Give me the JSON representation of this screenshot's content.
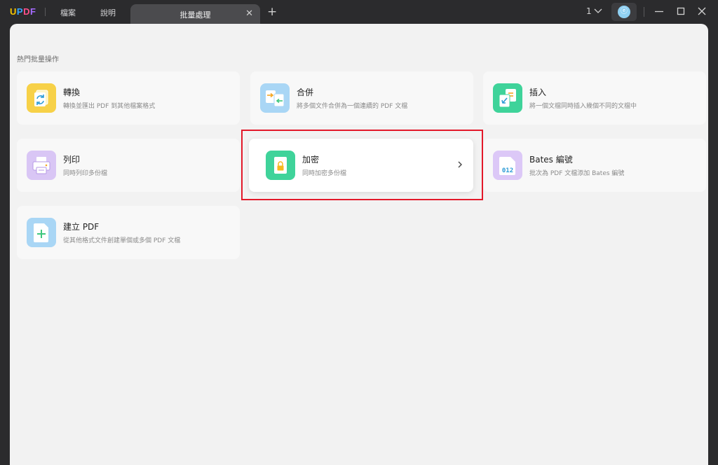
{
  "titlebar": {
    "logo": [
      "U",
      "P",
      "D",
      "F"
    ],
    "menu": {
      "file": "檔案",
      "help": "說明"
    },
    "tab": {
      "title": "批量處理",
      "close": "✕"
    },
    "add_tab": "+",
    "page_number": "1",
    "avatar_letter": "ⓔ"
  },
  "section_title": "熱門批量操作",
  "cards": [
    {
      "title": "轉換",
      "desc": "轉換並匯出 PDF 到其他檔案格式"
    },
    {
      "title": "合併",
      "desc": "將多個文件合併為一個連續的 PDF 文檔"
    },
    {
      "title": "插入",
      "desc": "將一個文檔同時插入幾個不同的文檔中"
    },
    {
      "title": "列印",
      "desc": "同時列印多份檔"
    },
    {
      "title": "加密",
      "desc": "同時加密多份檔"
    },
    {
      "title": "Bates 編號",
      "desc": "批次為 PDF 文檔添加 Bates 編號"
    },
    {
      "title": "建立 PDF",
      "desc": "從其他格式文件創建單個或多個 PDF 文檔"
    }
  ],
  "bates_icon_text": "012",
  "colors": {
    "titlebar_bg": "#2b2b2d",
    "content_bg": "#f2f2f2",
    "highlight": "#e3192a",
    "convert": "#f7d148",
    "merge": "#a9d6f5",
    "insert": "#3fd39a",
    "print": "#d9c6f5",
    "encrypt": "#3fd39a",
    "bates": "#dcc8f7",
    "create": "#a9d6f5"
  },
  "icons": {
    "convert": "refresh-icon",
    "merge": "merge-icon",
    "insert": "insert-icon",
    "print": "printer-icon",
    "encrypt": "lock-icon",
    "bates": "bates-number-icon",
    "create": "add-document-icon"
  }
}
